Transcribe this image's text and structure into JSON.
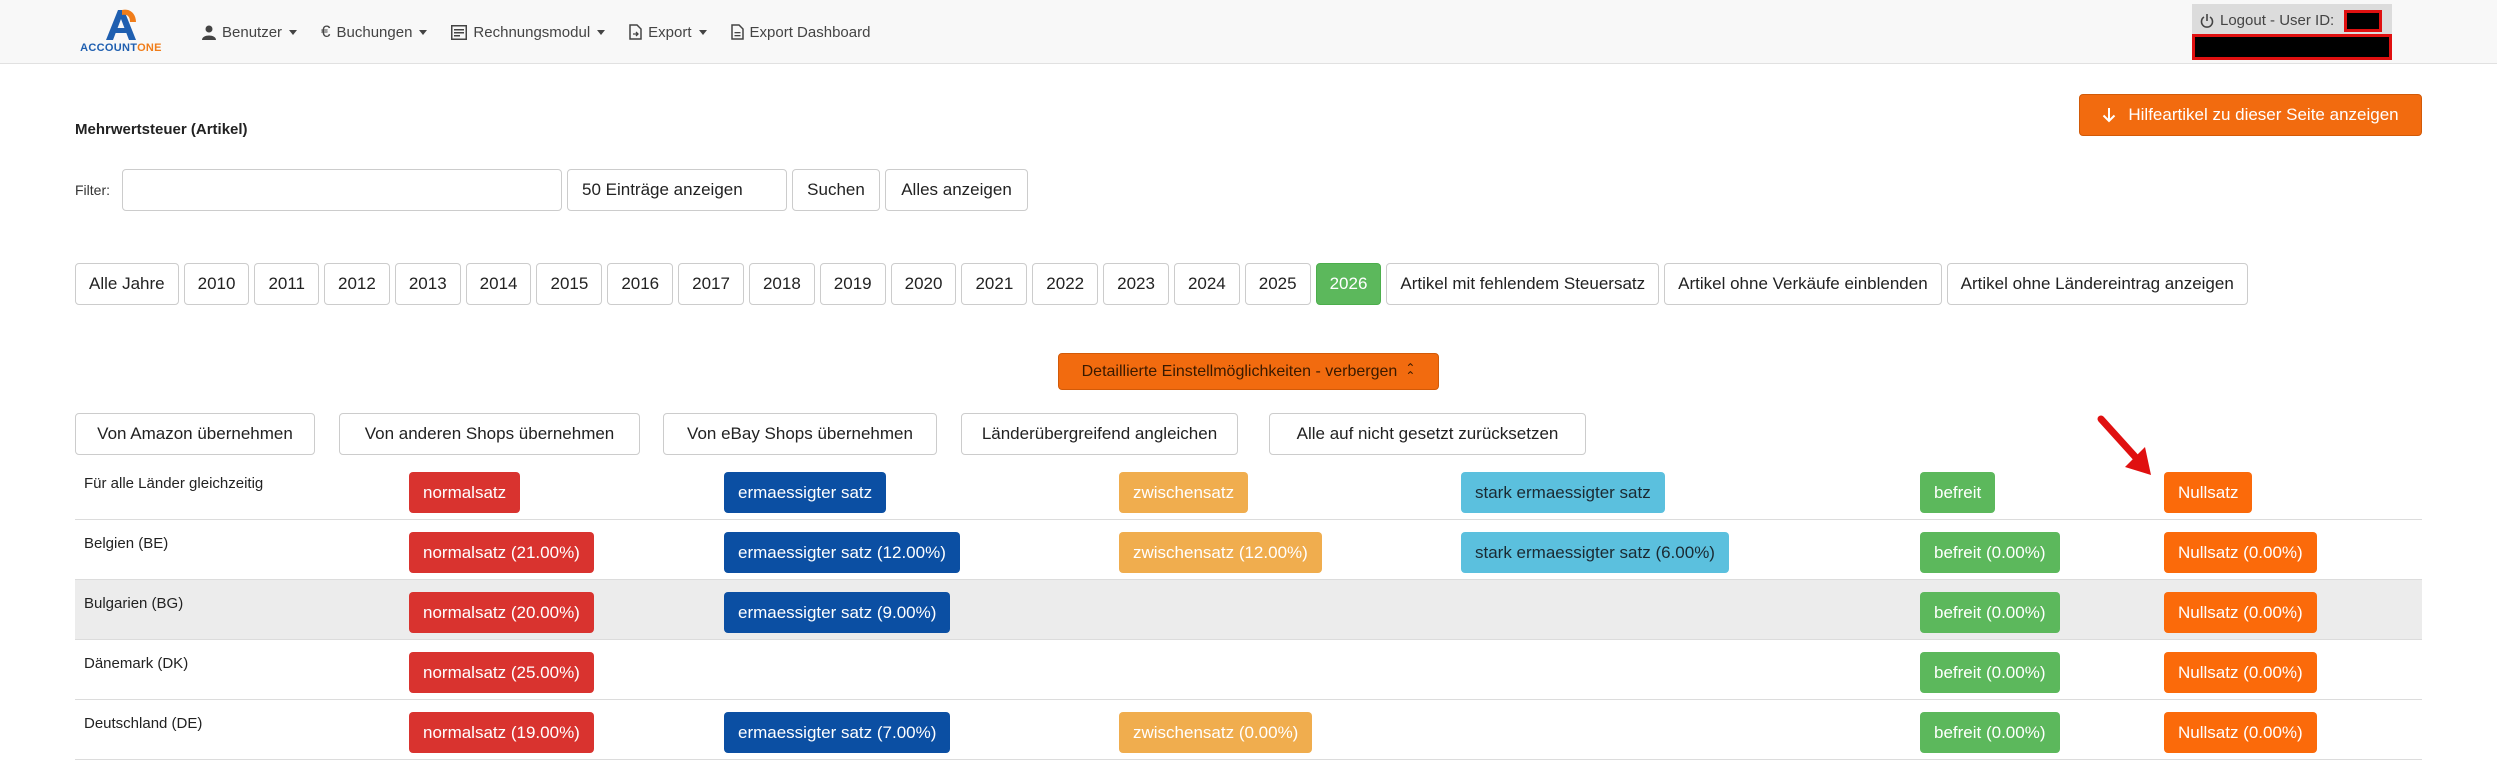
{
  "nav": {
    "logo_text_a": "ACCOUNT",
    "logo_text_b": "ONE",
    "items": [
      {
        "label": "Benutzer",
        "icon": "user-icon",
        "dropdown": true
      },
      {
        "label": "Buchungen",
        "icon": "euro-icon",
        "dropdown": true
      },
      {
        "label": "Rechnungsmodul",
        "icon": "invoice-icon",
        "dropdown": true
      },
      {
        "label": "Export",
        "icon": "file-export-icon",
        "dropdown": true
      },
      {
        "label": "Export Dashboard",
        "icon": "file-icon",
        "dropdown": false
      }
    ],
    "logout_label": "Logout - User ID:"
  },
  "page": {
    "title": "Mehrwertsteuer (Artikel)",
    "help_button": "Hilfeartikel zu dieser Seite anzeigen"
  },
  "filter": {
    "label": "Filter:",
    "value": "",
    "entries_select": "50 Einträge anzeigen",
    "search_button": "Suchen",
    "show_all_button": "Alles anzeigen"
  },
  "years": {
    "items": [
      "Alle Jahre",
      "2010",
      "2011",
      "2012",
      "2013",
      "2014",
      "2015",
      "2016",
      "2017",
      "2018",
      "2019",
      "2020",
      "2021",
      "2022",
      "2023",
      "2024",
      "2025",
      "2026",
      "Artikel mit fehlendem Steuersatz",
      "Artikel ohne Verkäufe einblenden",
      "Artikel ohne Ländereintrag anzeigen"
    ],
    "active": "2026"
  },
  "details_toggle": "Detaillierte Einstellmöglichkeiten - verbergen",
  "actions": [
    "Von Amazon übernehmen",
    "Von anderen Shops übernehmen",
    "Von eBay Shops übernehmen",
    "Länderübergreifend angleichen",
    "Alle auf nicht gesetzt zurücksetzen"
  ],
  "rows": [
    {
      "country": "Für alle Länder gleichzeitig",
      "normal": "normalsatz",
      "erm": "ermaessigter satz",
      "zw": "zwischensatz",
      "stark": "stark ermaessigter satz",
      "bef": "befreit",
      "null": "Nullsatz"
    },
    {
      "country": "Belgien (BE)",
      "normal": "normalsatz (21.00%)",
      "erm": "ermaessigter satz (12.00%)",
      "zw": "zwischensatz (12.00%)",
      "stark": "stark ermaessigter satz (6.00%)",
      "bef": "befreit (0.00%)",
      "null": "Nullsatz (0.00%)"
    },
    {
      "country": "Bulgarien (BG)",
      "normal": "normalsatz (20.00%)",
      "erm": "ermaessigter satz (9.00%)",
      "bef": "befreit (0.00%)",
      "null": "Nullsatz (0.00%)"
    },
    {
      "country": "Dänemark (DK)",
      "normal": "normalsatz (25.00%)",
      "bef": "befreit (0.00%)",
      "null": "Nullsatz (0.00%)"
    },
    {
      "country": "Deutschland (DE)",
      "normal": "normalsatz (19.00%)",
      "erm": "ermaessigter satz (7.00%)",
      "zw": "zwischensatz (0.00%)",
      "bef": "befreit (0.00%)",
      "null": "Nullsatz (0.00%)"
    }
  ],
  "colors": {
    "normal": "#d9332f",
    "erm": "#0b4fa3",
    "zw": "#f0ad4e",
    "stark": "#5bc0de",
    "bef": "#5cb85c",
    "null": "#fb6a0a",
    "active_year": "#5cb85c",
    "accent": "#f26b0f"
  }
}
